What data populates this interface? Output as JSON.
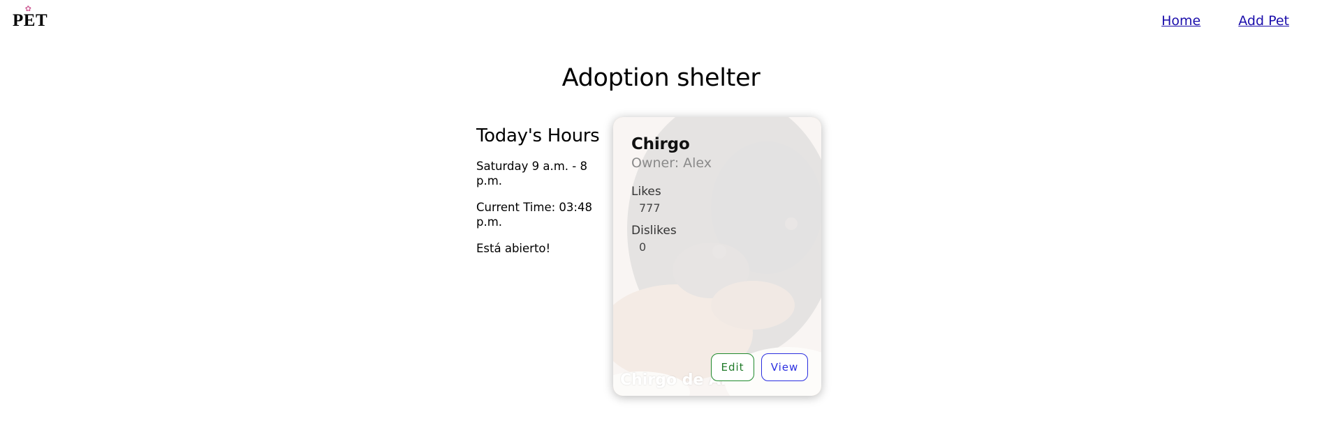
{
  "header": {
    "logo_text": "PET",
    "logo_icon": "paw-icon",
    "nav": [
      {
        "label": "Home"
      },
      {
        "label": "Add Pet"
      }
    ],
    "link_color": "#1a0dab"
  },
  "page": {
    "title": "Adoption shelter"
  },
  "hours": {
    "heading": "Today's Hours",
    "schedule": "Saturday 9 a.m. - 8 p.m.",
    "current_time": "Current Time: 03:48 p.m.",
    "status": "Está abierto!"
  },
  "pet_card": {
    "name": "Chirgo",
    "owner": "Owner: Alex",
    "likes_label": "Likes",
    "likes_value": "777",
    "dislikes_label": "Dislikes",
    "dislikes_value": "0",
    "caption": "Chirgo de Alex",
    "edit_label": "Edit",
    "view_label": "View",
    "edit_color": "#1f8a2c",
    "view_color": "#2a2ee0"
  }
}
